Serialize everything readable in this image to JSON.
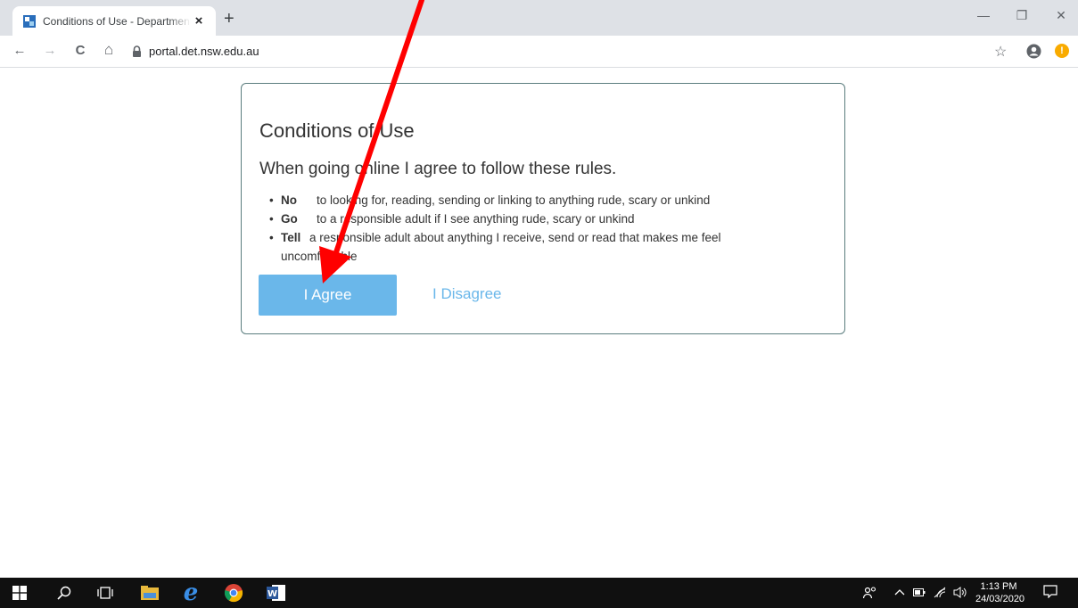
{
  "browser": {
    "tab_title": "Conditions of Use - Department of Education",
    "tab_close": "×",
    "new_tab": "+",
    "url": "portal.det.nsw.edu.au",
    "controls": {
      "minimize": "—",
      "restore": "❐",
      "close": "✕"
    },
    "nav": {
      "back": "←",
      "forward": "→",
      "reload": "C",
      "home": "⌂"
    },
    "bookmark": "☆",
    "update_badge": "!"
  },
  "page": {
    "title": "Conditions of Use",
    "subtitle": "When going online I agree to follow these rules.",
    "rules": [
      {
        "keyword": "No",
        "text": "to looking for, reading, sending or linking to anything rude, scary or unkind"
      },
      {
        "keyword": "Go",
        "text": "to a responsible adult if I see anything rude, scary or unkind"
      },
      {
        "keyword": "Tell",
        "text": "a responsible adult about anything I receive, send or read that makes me feel uncomfortable"
      }
    ],
    "agree_label": "I Agree",
    "disagree_label": "I Disagree",
    "colors": {
      "button": "#6ab7ea",
      "border": "#5b7d7e",
      "arrow": "#ff0000"
    }
  },
  "taskbar": {
    "time": "1:13 PM",
    "date": "24/03/2020",
    "apps": [
      "windows-start",
      "search",
      "task-view",
      "file-explorer",
      "internet-explorer",
      "chrome",
      "word"
    ]
  }
}
